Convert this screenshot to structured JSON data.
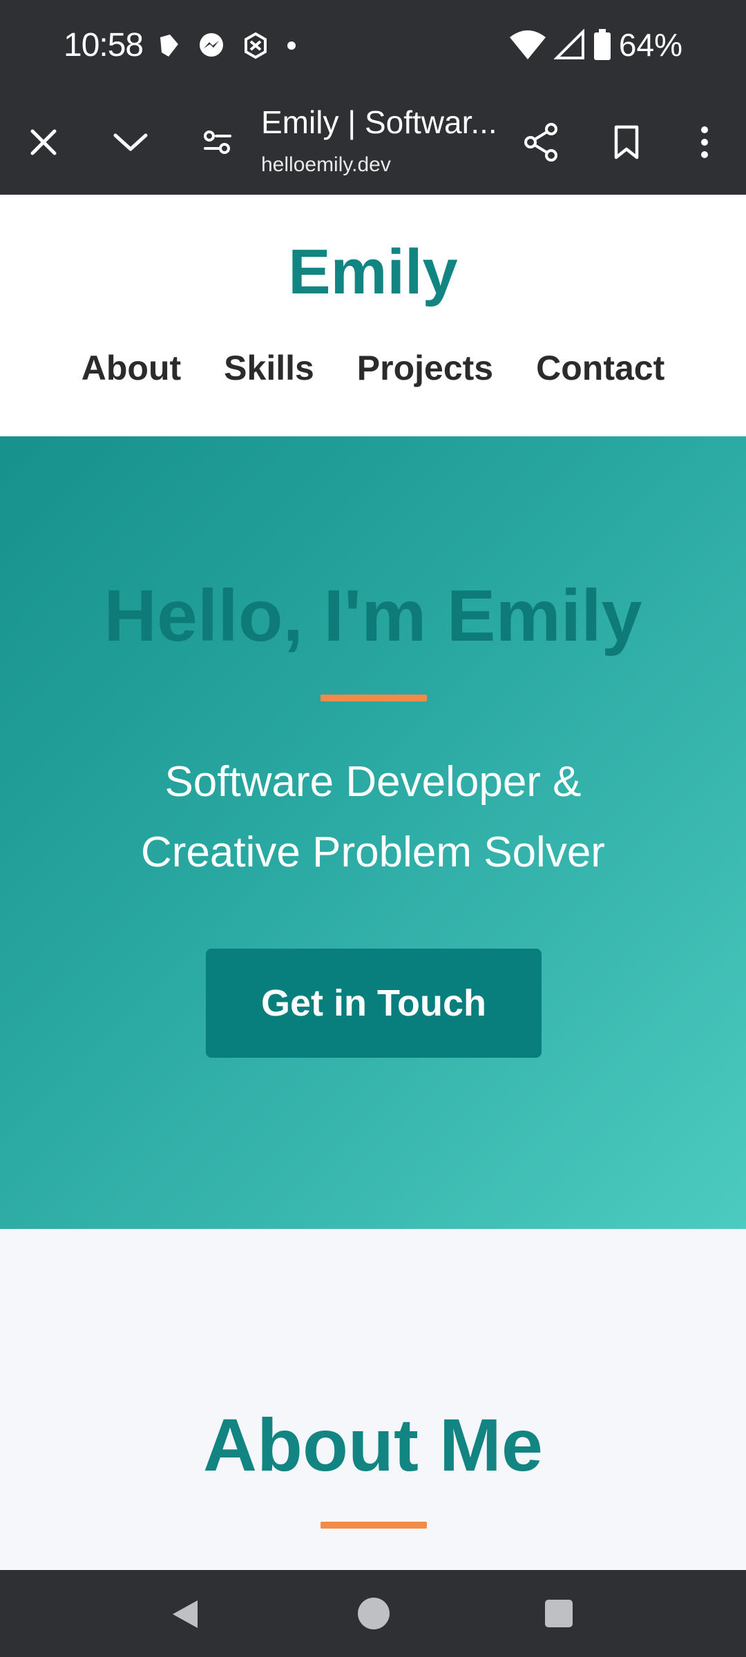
{
  "status_bar": {
    "time": "10:58",
    "battery_percent": "64%",
    "left_icons": [
      "notification-app-icon",
      "messenger-icon",
      "app-icon",
      "dot-icon"
    ],
    "right_icons": [
      "wifi-icon",
      "signal-icon",
      "battery-icon"
    ]
  },
  "browser": {
    "page_title": "Emily | Softwar...",
    "url": "helloemily.dev",
    "icons": [
      "close-icon",
      "chevron-down-icon",
      "site-settings-icon",
      "share-icon",
      "bookmark-icon",
      "more-icon"
    ]
  },
  "site": {
    "logo": "Emily",
    "nav": [
      "About",
      "Skills",
      "Projects",
      "Contact"
    ]
  },
  "hero": {
    "title": "Hello, I'm Emily",
    "subtitle_line1": "Software Developer &",
    "subtitle_line2": "Creative Problem Solver",
    "cta_label": "Get in Touch"
  },
  "about": {
    "title": "About Me"
  },
  "colors": {
    "brand_teal": "#128583",
    "accent_orange": "#f48a47",
    "button_teal": "#087f7c"
  }
}
